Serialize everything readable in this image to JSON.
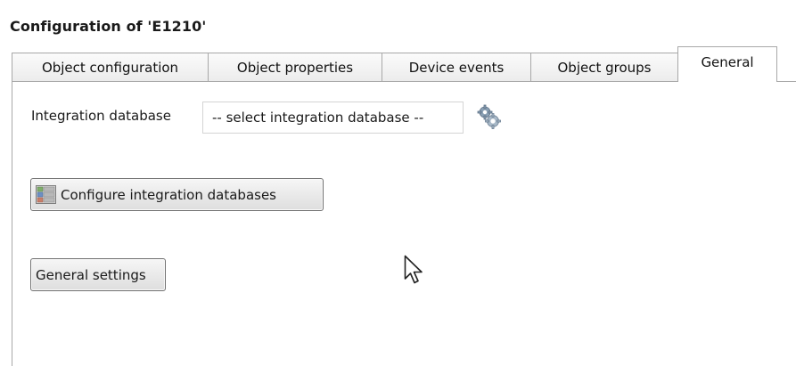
{
  "window": {
    "title": "Configuration of 'E1210'"
  },
  "tabs": [
    {
      "label": "Object configuration",
      "active": false
    },
    {
      "label": "Object properties",
      "active": false
    },
    {
      "label": "Device events",
      "active": false
    },
    {
      "label": "Object groups",
      "active": false
    },
    {
      "label": "General",
      "active": true
    }
  ],
  "general": {
    "integration_database_label": "Integration database",
    "integration_database_value": "-- select integration database --",
    "configure_button_label": "Configure integration databases",
    "general_settings_button_label": "General settings"
  },
  "icons": {
    "gear": "gear-icon",
    "database": "database-icon",
    "cursor": "mouse-pointer-icon"
  }
}
